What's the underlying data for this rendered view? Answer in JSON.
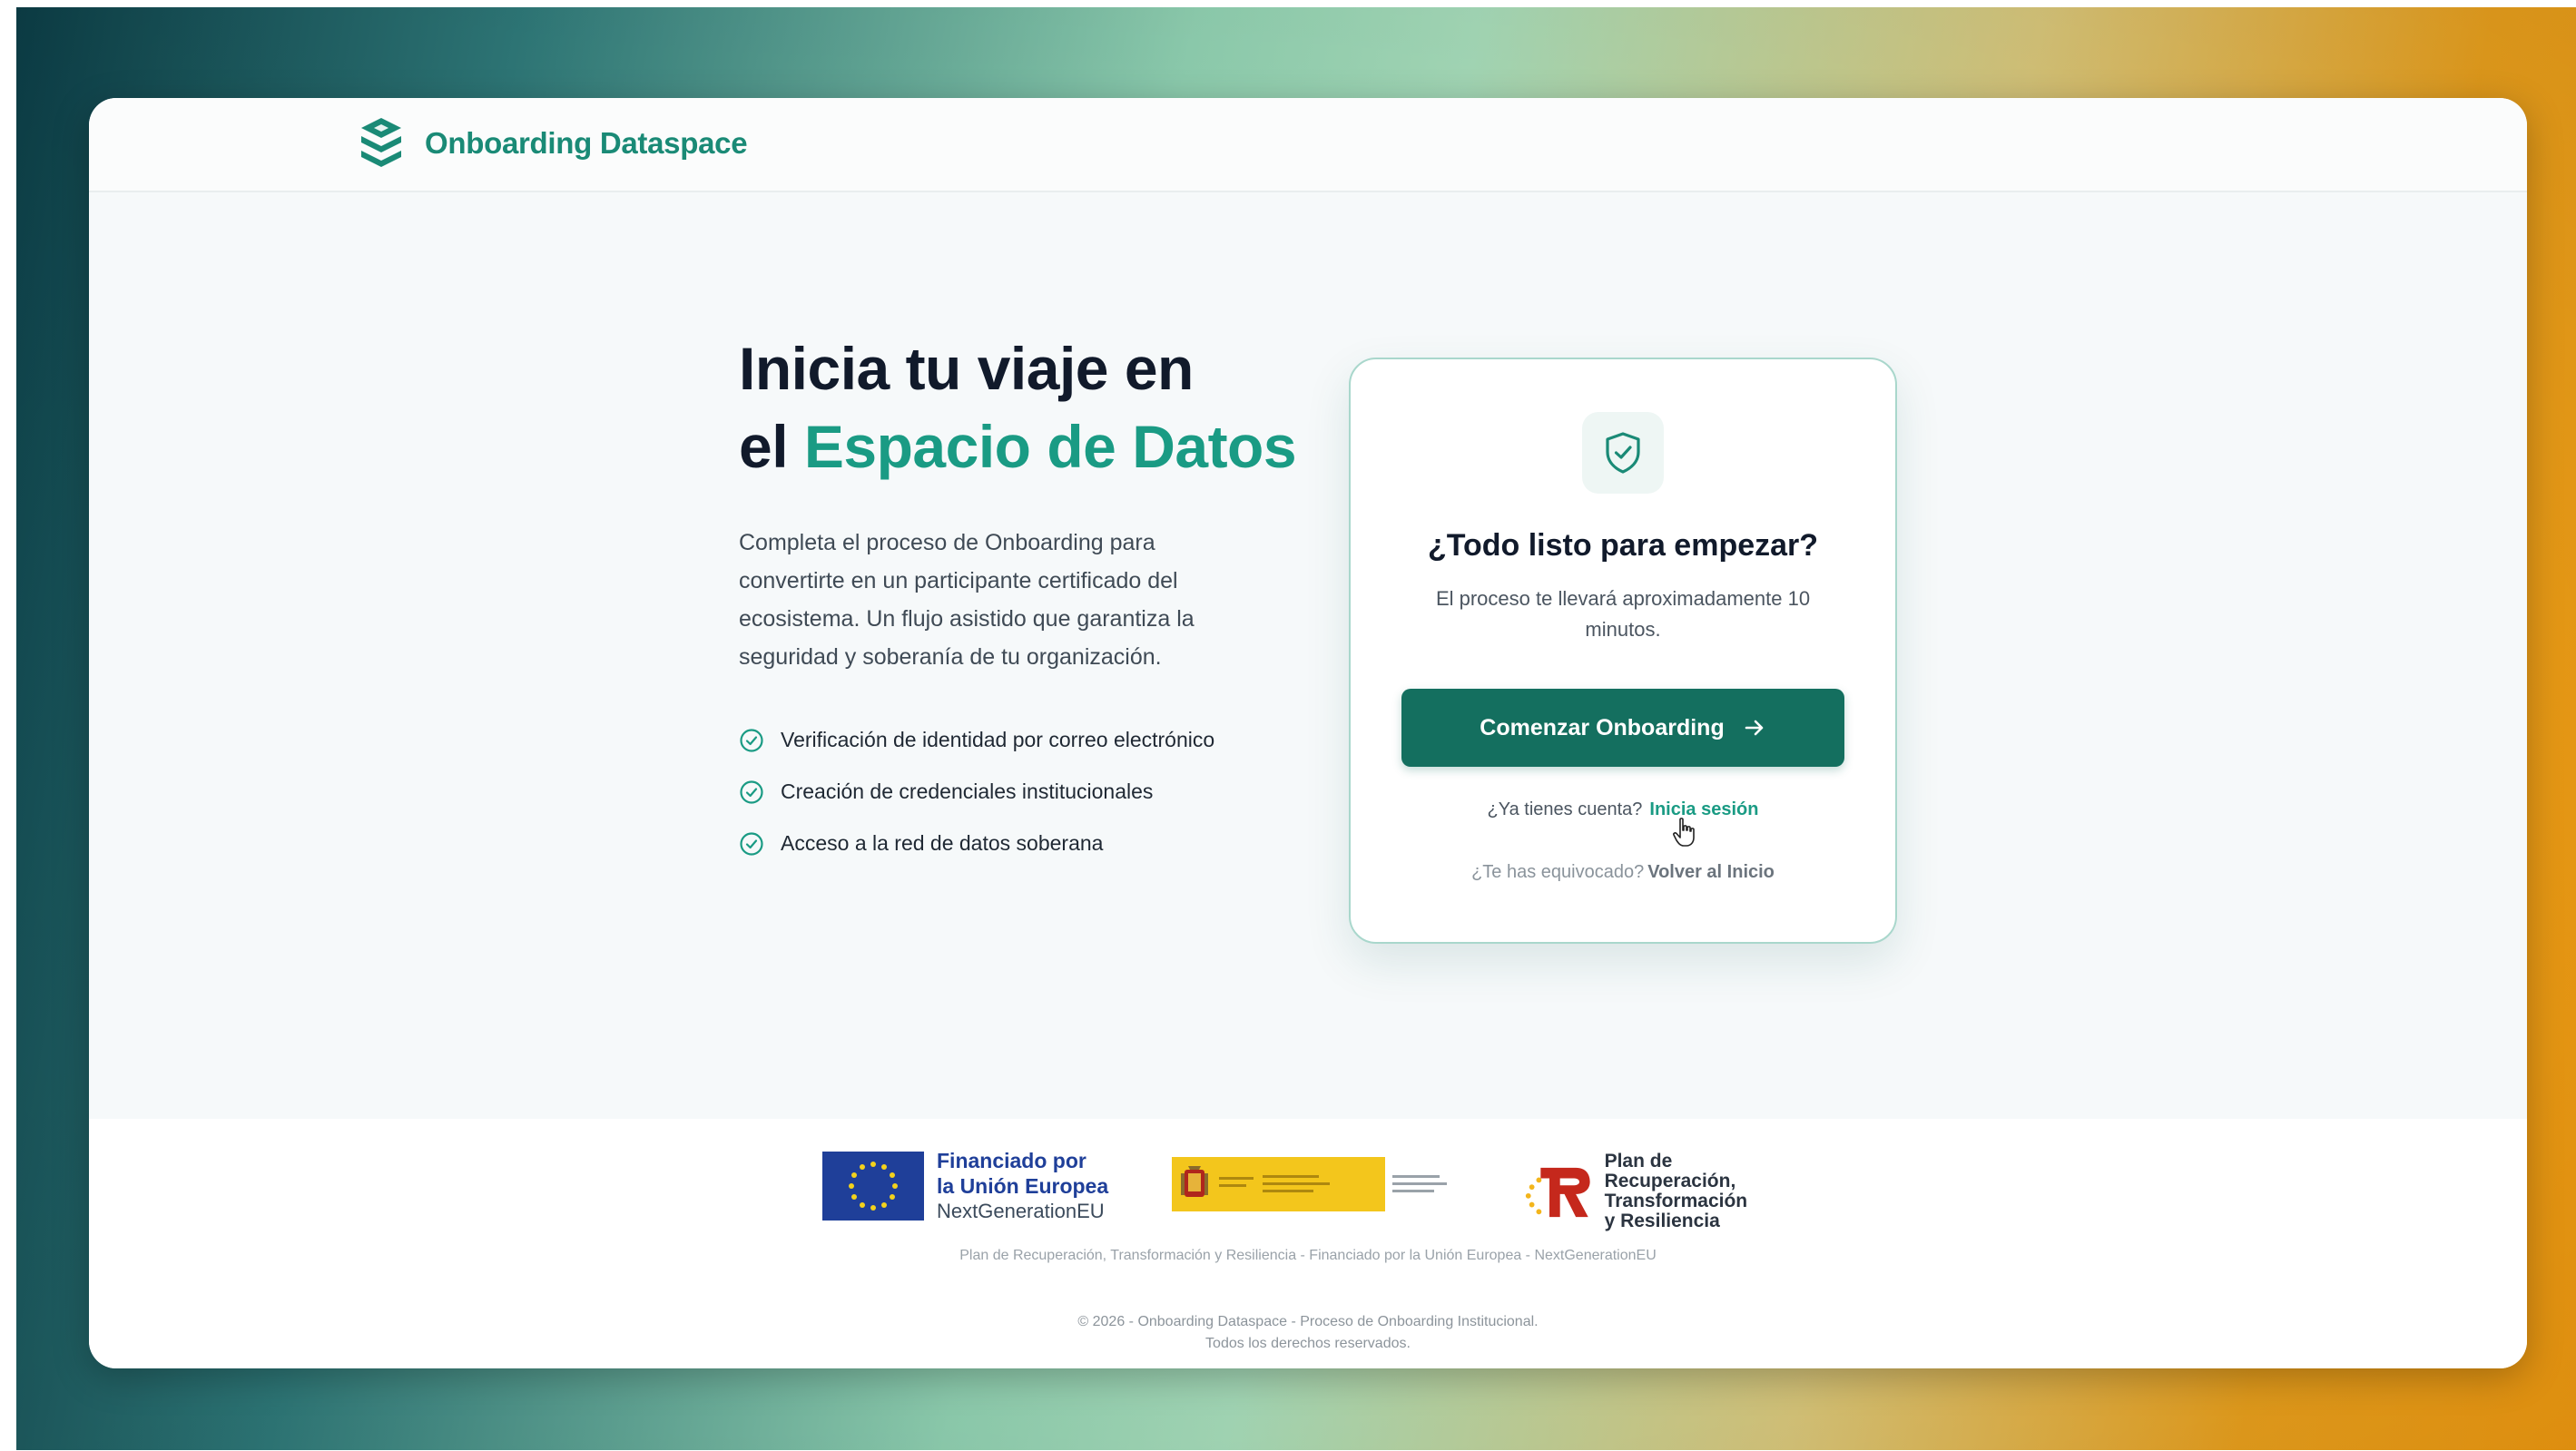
{
  "app": {
    "brand_name": "Onboarding Dataspace",
    "brand_color": "#1a8a76"
  },
  "hero": {
    "title_line1": "Inicia tu viaje en",
    "title_line2_prefix": "el ",
    "title_accent": "Espacio de Datos",
    "description": "Completa el proceso de Onboarding para convertirte en un participante certificado del ecosistema. Un flujo asistido que garantiza la seguridad y soberanía de tu organización.",
    "features": [
      "Verificación de identidad por correo electrónico",
      "Creación de credenciales institucionales",
      "Acceso a la red de datos soberana"
    ]
  },
  "card": {
    "icon": "shield-check-icon",
    "title": "¿Todo listo para empezar?",
    "subtitle": "El proceso te llevará aproximadamente 10 minutos.",
    "cta_label": "Comenzar Onboarding",
    "login_prompt": "¿Ya tienes cuenta?",
    "login_link": "Inicia sesión",
    "back_prompt": "¿Te has equivocado?",
    "back_link": "Volver al Inicio"
  },
  "footer": {
    "eu_line1": "Financiado por",
    "eu_line2": "la Unión Europea",
    "eu_line3": "NextGenerationEU",
    "prtr_line1": "Plan de Recuperación,",
    "prtr_line2": "Transformación",
    "prtr_line3": "y Resiliencia",
    "note": "Plan de Recuperación, Transformación y Resiliencia - Financiado por la Unión Europea - NextGenerationEU",
    "copyright_line1": "© 2026 - Onboarding Dataspace - Proceso de Onboarding Institucional.",
    "copyright_line2": "Todos los derechos reservados."
  },
  "colors": {
    "accent": "#1a9b84",
    "button": "#146f5f",
    "heading": "#111a2b"
  }
}
